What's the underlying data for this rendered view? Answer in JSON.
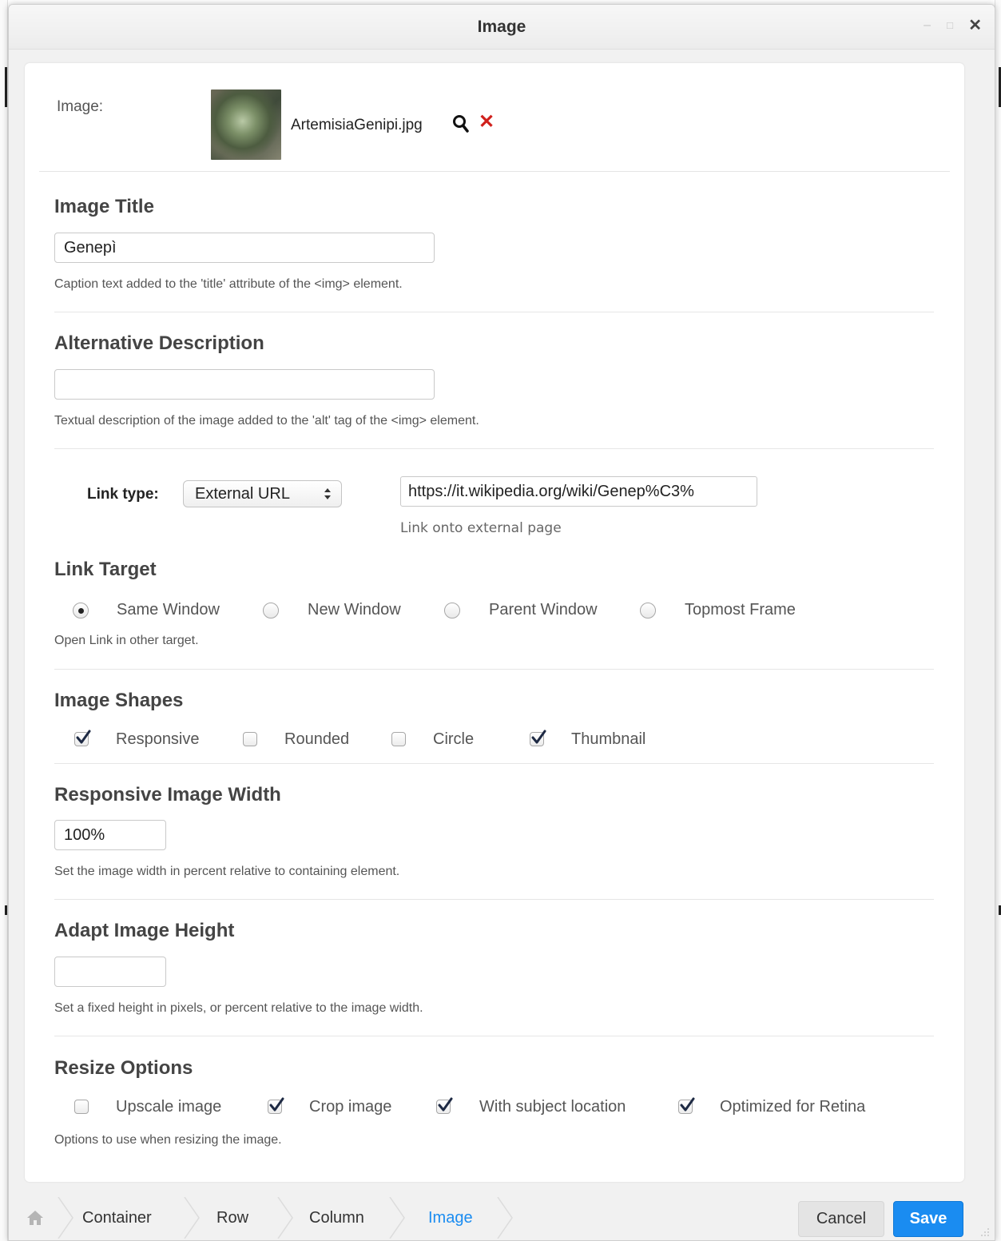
{
  "window": {
    "title": "Image",
    "minimize": "–",
    "maximize": "□",
    "close": "✕"
  },
  "image_field": {
    "label": "Image:",
    "filename": "ArtemisiaGenipi.jpg",
    "thumbnail_icon": "image-thumbnail",
    "browse_icon": "magnifier-icon",
    "remove_icon": "close-x-icon",
    "remove_glyph": "✕"
  },
  "image_title": {
    "heading": "Image Title",
    "value": "Genepì",
    "help": "Caption text added to the 'title' attribute of the <img> element."
  },
  "alt_description": {
    "heading": "Alternative Description",
    "value": "",
    "help": "Textual description of the image added to the 'alt' tag of the <img> element."
  },
  "link": {
    "label": "Link type:",
    "type_selected": "External URL",
    "url_value": "https://it.wikipedia.org/wiki/Genep%C3%",
    "url_help": "Link onto external page"
  },
  "link_target": {
    "heading": "Link Target",
    "options": [
      {
        "label": "Same Window",
        "selected": true
      },
      {
        "label": "New Window",
        "selected": false
      },
      {
        "label": "Parent Window",
        "selected": false
      },
      {
        "label": "Topmost Frame",
        "selected": false
      }
    ],
    "help": "Open Link in other target."
  },
  "image_shapes": {
    "heading": "Image Shapes",
    "options": [
      {
        "label": "Responsive",
        "checked": true
      },
      {
        "label": "Rounded",
        "checked": false
      },
      {
        "label": "Circle",
        "checked": false
      },
      {
        "label": "Thumbnail",
        "checked": true
      }
    ]
  },
  "responsive_width": {
    "heading": "Responsive Image Width",
    "value": "100%",
    "help": "Set the image width in percent relative to containing element."
  },
  "adapt_height": {
    "heading": "Adapt Image Height",
    "value": "",
    "help": "Set a fixed height in pixels, or percent relative to the image width."
  },
  "resize_options": {
    "heading": "Resize Options",
    "options": [
      {
        "label": "Upscale image",
        "checked": false
      },
      {
        "label": "Crop image",
        "checked": true
      },
      {
        "label": "With subject location",
        "checked": true
      },
      {
        "label": "Optimized for Retina",
        "checked": true
      }
    ],
    "help": "Options to use when resizing the image."
  },
  "footer": {
    "breadcrumbs": [
      "Container",
      "Row",
      "Column",
      "Image"
    ],
    "active_crumb_color": "#1a8cf1",
    "cancel_label": "Cancel",
    "save_label": "Save",
    "save_color": "#1a8cf1"
  }
}
